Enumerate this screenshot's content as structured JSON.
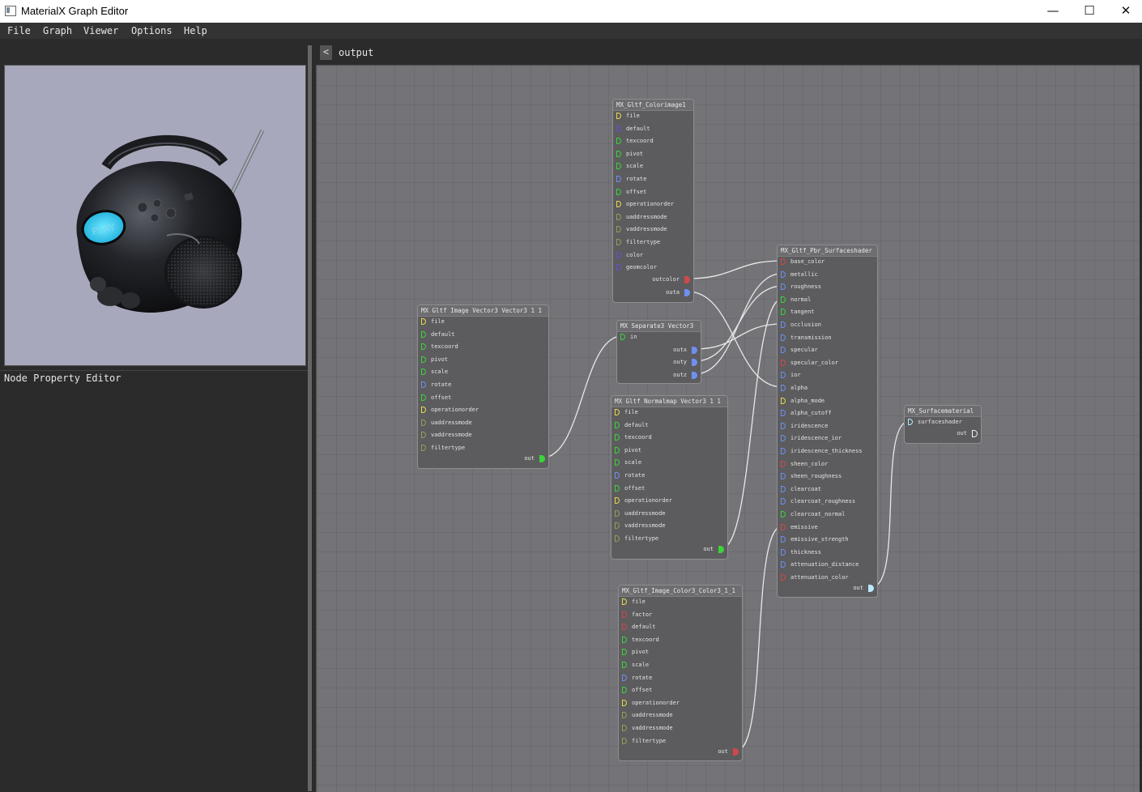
{
  "window": {
    "title": "MaterialX Graph Editor"
  },
  "window_controls": {
    "minimize": "—",
    "maximize": "☐",
    "close": "✕"
  },
  "menu": [
    "File",
    "Graph",
    "Viewer",
    "Options",
    "Help"
  ],
  "viewer": {
    "screen_text": "PLAY"
  },
  "property_editor": {
    "title": "Node Property Editor"
  },
  "graph": {
    "back_label": "<",
    "breadcrumb": "output",
    "colors": {
      "yellow": "#e8d84a",
      "green": "#3ad43a",
      "blue": "#6f8ff0",
      "purple": "#6a4fd0",
      "red": "#d24848",
      "olive": "#9a9a5a",
      "white": "#f0f0f0",
      "cyan": "#b8e8ff",
      "edge": "#e8e8e8"
    },
    "nodes": [
      {
        "id": "color_image",
        "title": "MX_Gltf_Colorimage1",
        "inputs": [
          {
            "label": "file",
            "color": "yellow"
          },
          {
            "label": "default",
            "color": "purple"
          },
          {
            "label": "texcoord",
            "color": "green"
          },
          {
            "label": "pivot",
            "color": "green"
          },
          {
            "label": "scale",
            "color": "green"
          },
          {
            "label": "rotate",
            "color": "blue"
          },
          {
            "label": "offset",
            "color": "green"
          },
          {
            "label": "operationorder",
            "color": "yellow"
          },
          {
            "label": "uaddressmode",
            "color": "olive"
          },
          {
            "label": "vaddressmode",
            "color": "olive"
          },
          {
            "label": "filtertype",
            "color": "olive"
          },
          {
            "label": "color",
            "color": "purple"
          },
          {
            "label": "geomcolor",
            "color": "purple"
          }
        ],
        "outputs": [
          {
            "label": "outcolor",
            "color": "red"
          },
          {
            "label": "outa",
            "color": "blue"
          }
        ]
      },
      {
        "id": "image_vector3",
        "title": "MX Gltf Image Vector3 Vector3 1 1",
        "inputs": [
          {
            "label": "file",
            "color": "yellow"
          },
          {
            "label": "default",
            "color": "green"
          },
          {
            "label": "texcoord",
            "color": "green"
          },
          {
            "label": "pivot",
            "color": "green"
          },
          {
            "label": "scale",
            "color": "green"
          },
          {
            "label": "rotate",
            "color": "blue"
          },
          {
            "label": "offset",
            "color": "green"
          },
          {
            "label": "operationorder",
            "color": "yellow"
          },
          {
            "label": "uaddressmode",
            "color": "olive"
          },
          {
            "label": "vaddressmode",
            "color": "olive"
          },
          {
            "label": "filtertype",
            "color": "olive"
          }
        ],
        "outputs": [
          {
            "label": "out",
            "color": "green"
          }
        ]
      },
      {
        "id": "separate3",
        "title": "MX Separate3 Vector3",
        "inputs": [
          {
            "label": "in",
            "color": "green"
          }
        ],
        "outputs": [
          {
            "label": "outx",
            "color": "blue"
          },
          {
            "label": "outy",
            "color": "blue"
          },
          {
            "label": "outz",
            "color": "blue"
          }
        ]
      },
      {
        "id": "normalmap",
        "title": "MX Gltf Normalmap Vector3 1 1",
        "inputs": [
          {
            "label": "file",
            "color": "yellow"
          },
          {
            "label": "default",
            "color": "green"
          },
          {
            "label": "texcoord",
            "color": "green"
          },
          {
            "label": "pivot",
            "color": "green"
          },
          {
            "label": "scale",
            "color": "green"
          },
          {
            "label": "rotate",
            "color": "blue"
          },
          {
            "label": "offset",
            "color": "green"
          },
          {
            "label": "operationorder",
            "color": "yellow"
          },
          {
            "label": "uaddressmode",
            "color": "olive"
          },
          {
            "label": "vaddressmode",
            "color": "olive"
          },
          {
            "label": "filtertype",
            "color": "olive"
          }
        ],
        "outputs": [
          {
            "label": "out",
            "color": "green"
          }
        ]
      },
      {
        "id": "image_color3",
        "title": "MX_Gltf_Image_Color3_Color3_1_1",
        "inputs": [
          {
            "label": "file",
            "color": "yellow"
          },
          {
            "label": "factor",
            "color": "red"
          },
          {
            "label": "default",
            "color": "red"
          },
          {
            "label": "texcoord",
            "color": "green"
          },
          {
            "label": "pivot",
            "color": "green"
          },
          {
            "label": "scale",
            "color": "green"
          },
          {
            "label": "rotate",
            "color": "blue"
          },
          {
            "label": "offset",
            "color": "green"
          },
          {
            "label": "operationorder",
            "color": "yellow"
          },
          {
            "label": "uaddressmode",
            "color": "olive"
          },
          {
            "label": "vaddressmode",
            "color": "olive"
          },
          {
            "label": "filtertype",
            "color": "olive"
          }
        ],
        "outputs": [
          {
            "label": "out",
            "color": "red"
          }
        ]
      },
      {
        "id": "pbr",
        "title": "MX_Gltf_Pbr_Surfaceshader",
        "inputs": [
          {
            "label": "base_color",
            "color": "red"
          },
          {
            "label": "metallic",
            "color": "blue"
          },
          {
            "label": "roughness",
            "color": "blue"
          },
          {
            "label": "normal",
            "color": "green"
          },
          {
            "label": "tangent",
            "color": "green"
          },
          {
            "label": "occlusion",
            "color": "blue"
          },
          {
            "label": "transmission",
            "color": "blue"
          },
          {
            "label": "specular",
            "color": "blue"
          },
          {
            "label": "specular_color",
            "color": "red"
          },
          {
            "label": "ior",
            "color": "blue"
          },
          {
            "label": "alpha",
            "color": "blue"
          },
          {
            "label": "alpha_mode",
            "color": "yellow"
          },
          {
            "label": "alpha_cutoff",
            "color": "blue"
          },
          {
            "label": "iridescence",
            "color": "blue"
          },
          {
            "label": "iridescence_ior",
            "color": "blue"
          },
          {
            "label": "iridescence_thickness",
            "color": "blue"
          },
          {
            "label": "sheen_color",
            "color": "red"
          },
          {
            "label": "sheen_roughness",
            "color": "blue"
          },
          {
            "label": "clearcoat",
            "color": "blue"
          },
          {
            "label": "clearcoat_roughness",
            "color": "blue"
          },
          {
            "label": "clearcoat_normal",
            "color": "green"
          },
          {
            "label": "emissive",
            "color": "red"
          },
          {
            "label": "emissive_strength",
            "color": "blue"
          },
          {
            "label": "thickness",
            "color": "blue"
          },
          {
            "label": "attenuation_distance",
            "color": "blue"
          },
          {
            "label": "attenuation_color",
            "color": "red"
          }
        ],
        "outputs": [
          {
            "label": "out",
            "color": "cyan"
          }
        ]
      },
      {
        "id": "surfacematerial",
        "title": "MX_Surfacematerial",
        "inputs": [
          {
            "label": "surfaceshader",
            "color": "cyan"
          }
        ],
        "outputs": [
          {
            "label": "out",
            "color": "white"
          }
        ]
      }
    ]
  }
}
